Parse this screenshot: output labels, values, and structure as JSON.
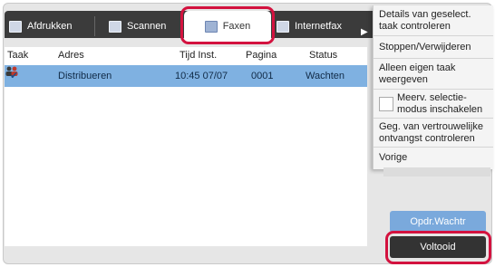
{
  "tabs": {
    "print": "Afdrukken",
    "scan": "Scannen",
    "fax": "Faxen",
    "internetfax": "Internetfax"
  },
  "columns": {
    "taak": "Taak",
    "adres": "Adres",
    "tijd": "Tijd Inst.",
    "pagina": "Pagina",
    "status": "Status"
  },
  "jobs": [
    {
      "adres": "Distribueren",
      "tijd": "10:45 07/07",
      "pagina": "0001",
      "status": "Wachten"
    }
  ],
  "menu": {
    "item1": "Details van geselect. taak controleren",
    "item2": "Stoppen/Verwijderen",
    "item3": "Alleen eigen taak weergeven",
    "item4": "Meerv. selectie-modus inschakelen",
    "item5": "Geg. van vertrouwelijke ontvangst controleren",
    "item6": "Vorige"
  },
  "buttons": {
    "opdr": "Opdr.Wachtr",
    "done": "Voltooid"
  },
  "colors": {
    "selected_row": "#7fb1e1",
    "highlight": "#d3123f",
    "button_blue": "#7aa9dc",
    "button_dark": "#333333"
  }
}
